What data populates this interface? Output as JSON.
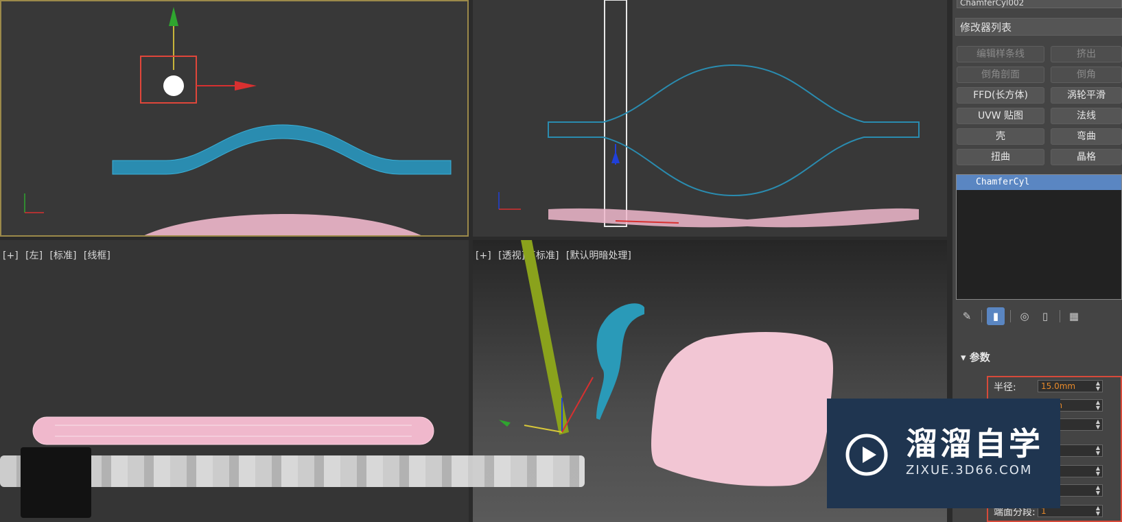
{
  "viewports": {
    "top_right_label": "",
    "bottom_left": {
      "tags": [
        "[+]",
        "[左]",
        "[标准]",
        "[线框]"
      ]
    },
    "bottom_right": {
      "tags": [
        "[+]",
        "[透视]",
        "[标准]",
        "[默认明暗处理]"
      ]
    }
  },
  "panel": {
    "object_name": "ChamferCyl002",
    "modifier_list_label": "修改器列表",
    "modifier_buttons": [
      {
        "label": "编辑样条线",
        "enabled": false
      },
      {
        "label": "挤出",
        "enabled": false
      },
      {
        "label": "倒角剖面",
        "enabled": false
      },
      {
        "label": "倒角",
        "enabled": false
      },
      {
        "label": "FFD(长方体)",
        "enabled": true
      },
      {
        "label": "涡轮平滑",
        "enabled": true
      },
      {
        "label": "UVW 贴图",
        "enabled": true
      },
      {
        "label": "法线",
        "enabled": true
      },
      {
        "label": "壳",
        "enabled": true
      },
      {
        "label": "弯曲",
        "enabled": true
      },
      {
        "label": "扭曲",
        "enabled": true
      },
      {
        "label": "晶格",
        "enabled": true
      }
    ],
    "stack_items": [
      "ChamferCyl"
    ],
    "stack_tools": [
      "pin-icon",
      "show-end-result-icon",
      "make-unique-icon",
      "remove-modifier-icon",
      "configure-icon"
    ],
    "rollout_title": "参数",
    "params": [
      {
        "label": "半径:",
        "value": "15.0mm"
      },
      {
        "label": "",
        "value": "0mm"
      },
      {
        "label": "",
        "value": "m"
      },
      {
        "label": "",
        "value": ""
      },
      {
        "label": "",
        "value": "0"
      },
      {
        "label": "",
        "value": ""
      },
      {
        "label": "",
        "value": ""
      },
      {
        "label": "端面分段:",
        "value": "1"
      }
    ]
  },
  "watermark": {
    "brand_cn": "溜溜自学",
    "url": "ZIXUE.3D66.COM"
  },
  "colors": {
    "accent_blue": "#5a86c2",
    "wire_blue": "#2a8cb0",
    "pink": "#f0b8cc",
    "highlight_red": "#d84a3a"
  }
}
